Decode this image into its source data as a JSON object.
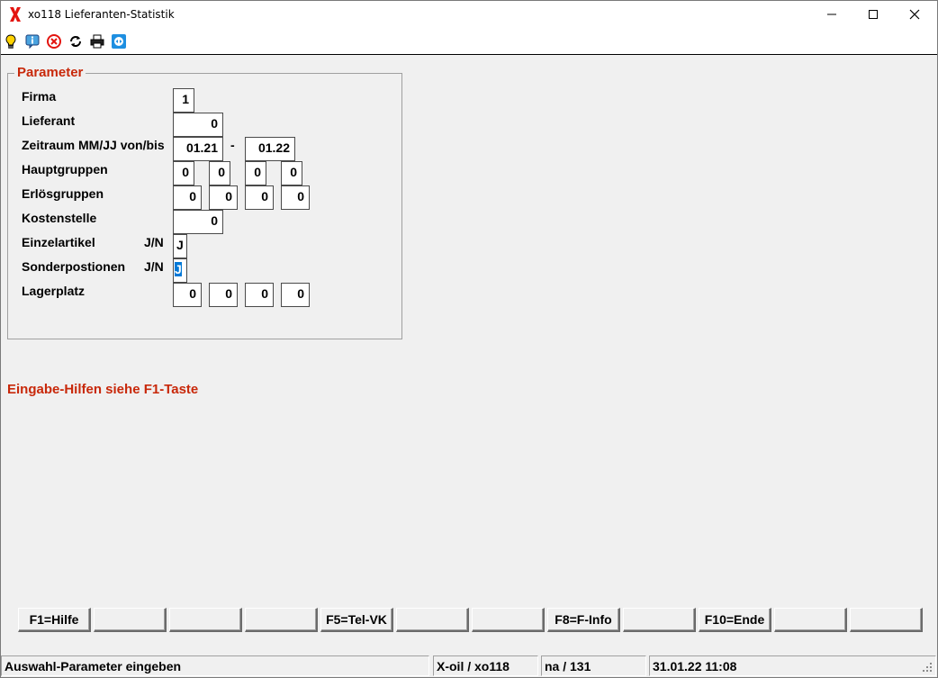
{
  "window": {
    "title": "xo118 Lieferanten-Statistik",
    "app_icon": "x-logo-icon",
    "controls": [
      "minimize-icon",
      "maximize-icon",
      "close-icon"
    ]
  },
  "toolbar": {
    "icons": [
      "lightbulb-icon",
      "info-icon",
      "cancel-circle-icon",
      "refresh-icon",
      "printer-icon",
      "remote-support-icon"
    ]
  },
  "parameter": {
    "legend": "Parameter",
    "firma": {
      "label": "Firma",
      "value": "1"
    },
    "lieferant": {
      "label": "Lieferant",
      "value": "0"
    },
    "zeitraum": {
      "label": "Zeitraum MM/JJ von/bis",
      "from": "01.21",
      "separator": "-",
      "to": "01.22"
    },
    "hauptgruppen": {
      "label": "Hauptgruppen",
      "values": [
        "0",
        "0",
        "0",
        "0"
      ]
    },
    "erloesgruppen": {
      "label": "Erlösgruppen",
      "values": [
        "0",
        "0",
        "0",
        "0"
      ]
    },
    "kostenstelle": {
      "label": "Kostenstelle",
      "value": "0"
    },
    "einzelartikel": {
      "label": "Einzelartikel",
      "hint": "J/N",
      "value": "J"
    },
    "sonderpositionen": {
      "label": "Sonderpostionen",
      "hint": "J/N",
      "value": "J"
    },
    "lagerplatz": {
      "label": "Lagerplatz",
      "values": [
        "0",
        "0",
        "0",
        "0"
      ]
    }
  },
  "hint_text": "Eingabe-Hilfen siehe F1-Taste",
  "function_keys": [
    "F1=Hilfe",
    "",
    "",
    "",
    "F5=Tel-VK",
    "",
    "",
    "F8=F-Info",
    "",
    "F10=Ende",
    "",
    ""
  ],
  "status_bar": {
    "message": "Auswahl-Parameter eingeben",
    "program": "X-oil / xo118",
    "user": "na / 131",
    "datetime": "31.01.22 11:08"
  },
  "colors": {
    "accent_red": "#c8280a",
    "selection_blue": "#0078d7"
  }
}
